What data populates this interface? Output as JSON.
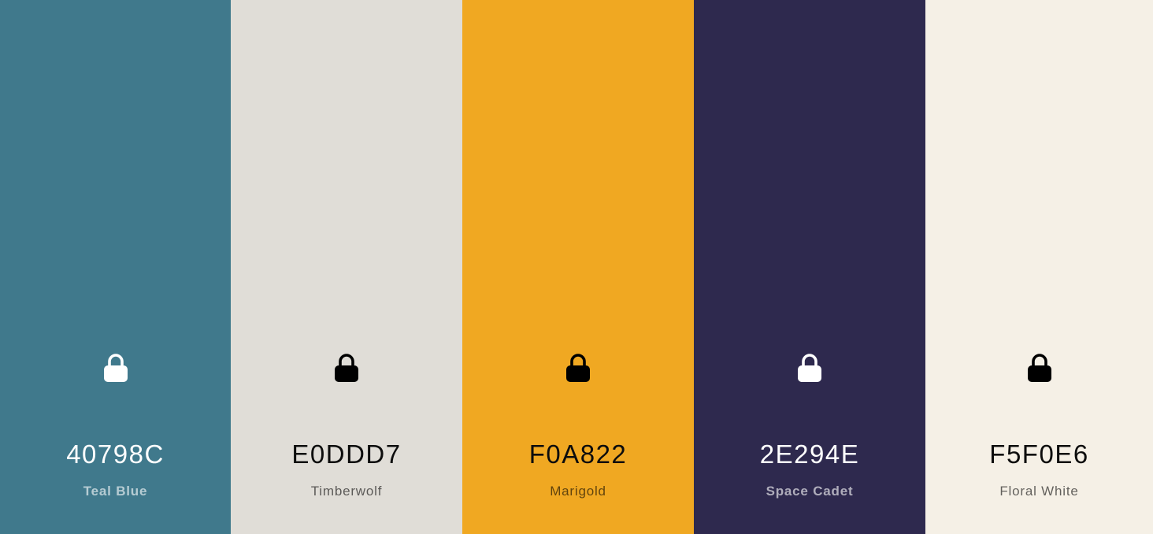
{
  "palette": {
    "swatches": [
      {
        "hex": "40798C",
        "name": "Teal Blue",
        "color": "#40798C",
        "lock_icon": "lock-icon",
        "lock_color": "#ffffff"
      },
      {
        "hex": "E0DDD7",
        "name": "Timberwolf",
        "color": "#E0DDD7",
        "lock_icon": "lock-icon",
        "lock_color": "#000000"
      },
      {
        "hex": "F0A822",
        "name": "Marigold",
        "color": "#F0A822",
        "lock_icon": "lock-icon",
        "lock_color": "#000000"
      },
      {
        "hex": "2E294E",
        "name": "Space Cadet",
        "color": "#2E294E",
        "lock_icon": "lock-icon",
        "lock_color": "#ffffff"
      },
      {
        "hex": "F5F0E6",
        "name": "Floral White",
        "color": "#F5F0E6",
        "lock_icon": "lock-icon",
        "lock_color": "#000000"
      }
    ]
  }
}
